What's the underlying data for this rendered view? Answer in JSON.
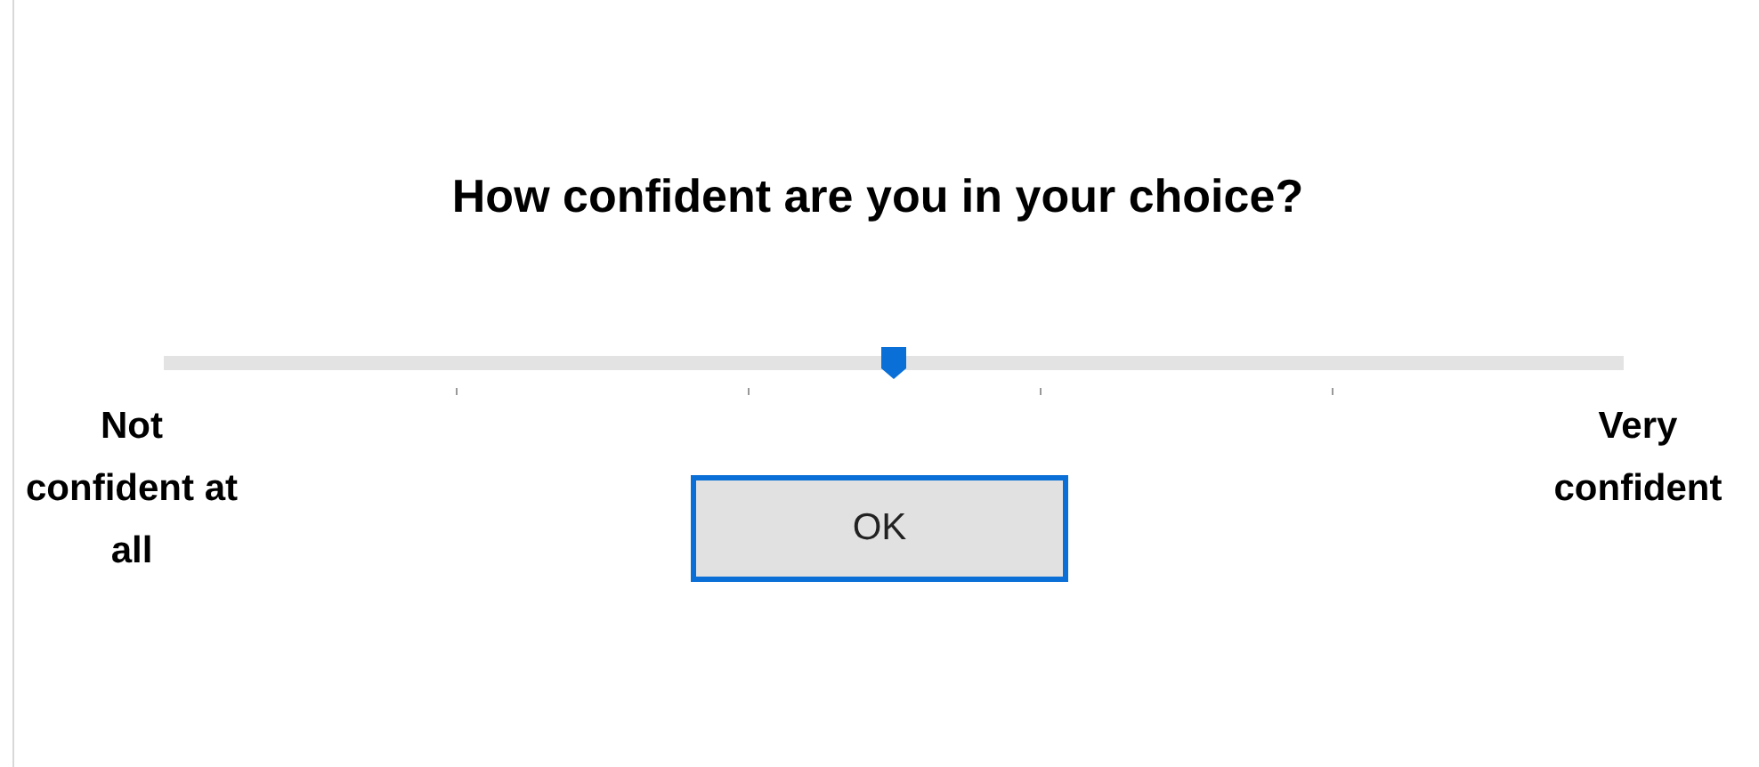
{
  "question": "How confident are you in your choice?",
  "slider": {
    "level": 0.5,
    "min_label": "Not confident at all",
    "max_label": "Very confident"
  },
  "button": {
    "label": "OK"
  }
}
